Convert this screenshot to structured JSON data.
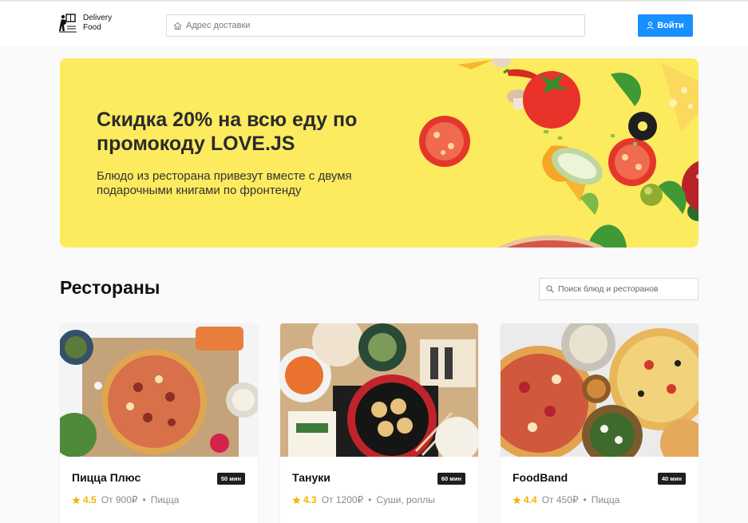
{
  "header": {
    "logo_line1": "Delivery",
    "logo_line2": "Food",
    "address_placeholder": "Адрес доставки",
    "login_label": "Войти"
  },
  "promo": {
    "title": "Скидка 20% на всю еду по промокоду LOVE.JS",
    "text": "Блюдо из ресторана привезут вместе с двумя подарочными книгами по фронтенду",
    "background": "#fdeb5f"
  },
  "restaurants": {
    "title": "Рестораны",
    "search_placeholder": "Поиск блюд и ресторанов",
    "items": [
      {
        "name": "Пицца Плюс",
        "time": "50 мин",
        "rating": "4.5",
        "price": "От 900₽",
        "category": "Пицца"
      },
      {
        "name": "Тануки",
        "time": "60 мин",
        "rating": "4.3",
        "price": "От 1200₽",
        "category": "Суши, роллы"
      },
      {
        "name": "FoodBand",
        "time": "40 мин",
        "rating": "4.4",
        "price": "От 450₽",
        "category": "Пицца"
      }
    ]
  },
  "colors": {
    "accent": "#1890ff",
    "star": "#f5b400",
    "badge": "#1f1f1f"
  },
  "icons": {
    "logo": "courier-icon",
    "address": "home-icon",
    "login": "user-icon",
    "search": "search-icon",
    "rating": "star-icon"
  }
}
